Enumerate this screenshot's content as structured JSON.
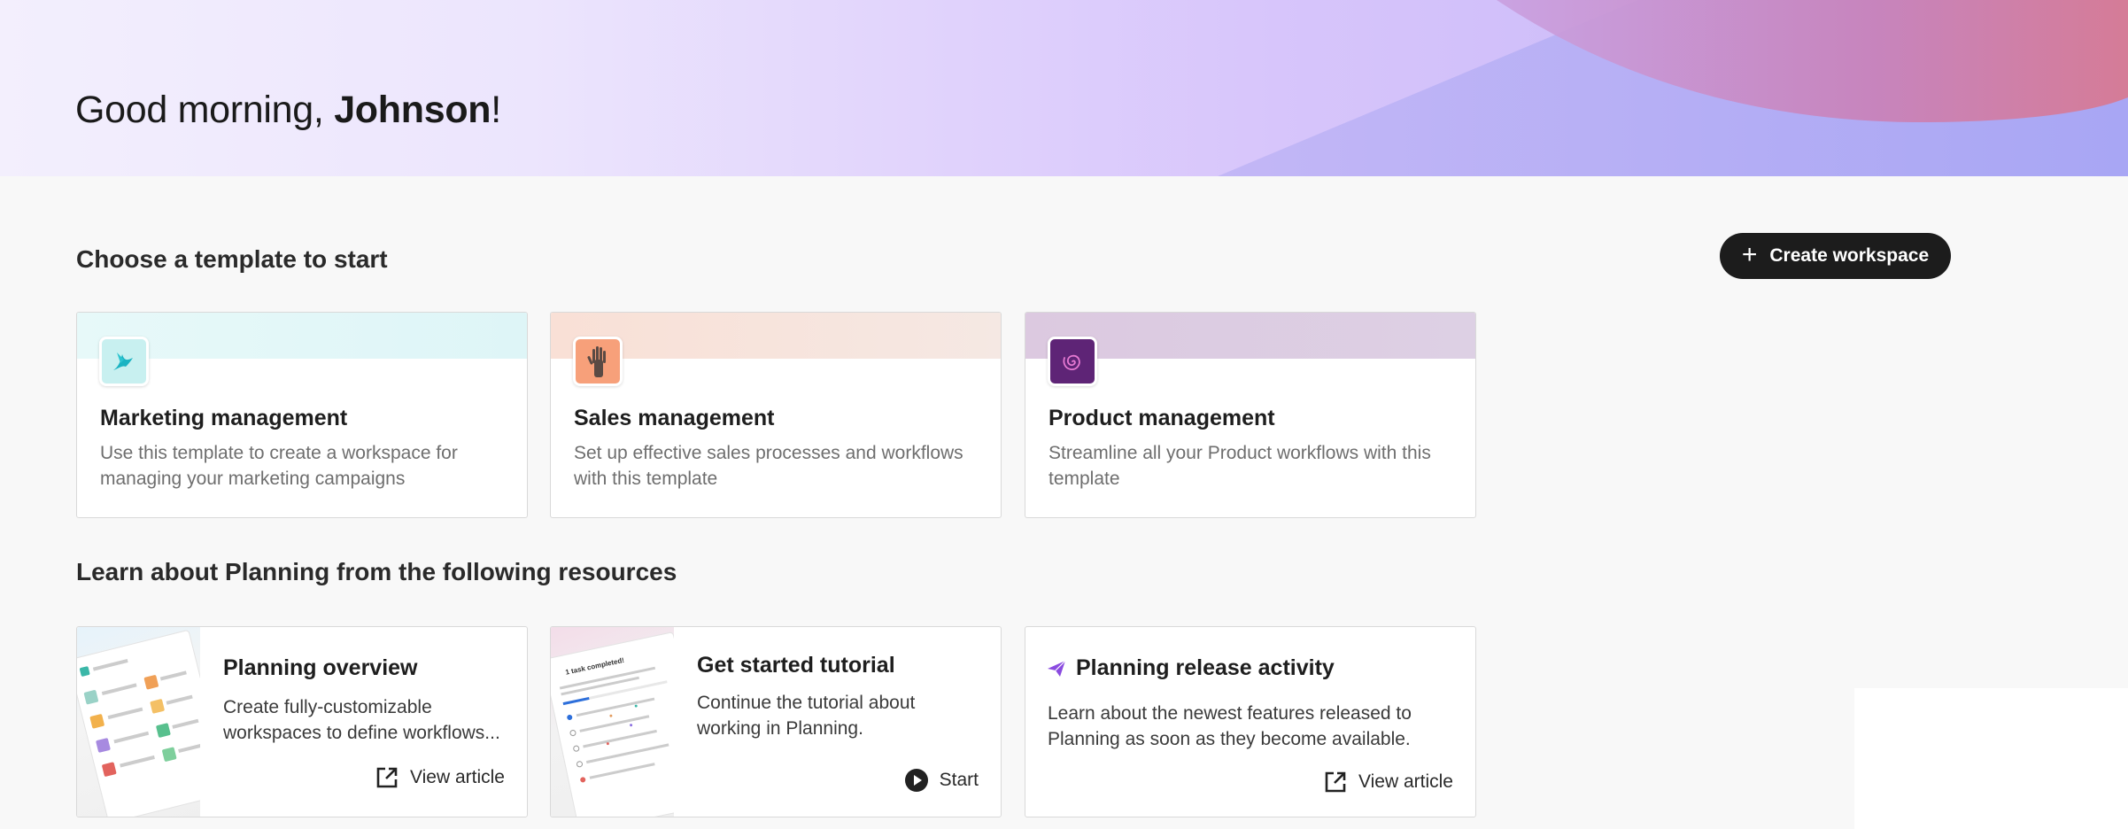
{
  "greeting": {
    "prefix": "Good morning, ",
    "name": "Johnson",
    "suffix": "!"
  },
  "templates_section": {
    "title": "Choose a template to start",
    "create_button": "Create workspace",
    "cards": [
      {
        "title": "Marketing management",
        "description": "Use this template to create a workspace for managing your marketing campaigns",
        "icon": "bird-icon",
        "band_color": "#e3f7f7"
      },
      {
        "title": "Sales management",
        "description": "Set up effective sales processes and workflows with this template",
        "icon": "raised-hand-icon",
        "band_color": "#f5e2da"
      },
      {
        "title": "Product management",
        "description": "Streamline all your Product workflows with this template",
        "icon": "spiral-icon",
        "band_color": "#dcccde"
      }
    ]
  },
  "resources_section": {
    "title": "Learn about Planning from the following resources",
    "cards": [
      {
        "title": "Planning overview",
        "description": "Create fully-customizable workspaces to define workflows...",
        "action": "View article",
        "action_icon": "external-link-icon"
      },
      {
        "title": "Get started tutorial",
        "description": "Continue the tutorial about working in Planning.",
        "action": "Start",
        "action_icon": "play-icon",
        "thumb_heading": "1 task completed!"
      },
      {
        "title": "Planning release activity",
        "description": "Learn about the newest features released to Planning as soon as they become available.",
        "action": "View article",
        "action_icon": "external-link-icon",
        "title_icon": "paper-plane-icon"
      }
    ]
  },
  "colors": {
    "accent_dark": "#1c1c1c",
    "hero_start": "#f3effd",
    "hero_end": "#c9b9f6",
    "hero_arc": "#d17b9c"
  }
}
